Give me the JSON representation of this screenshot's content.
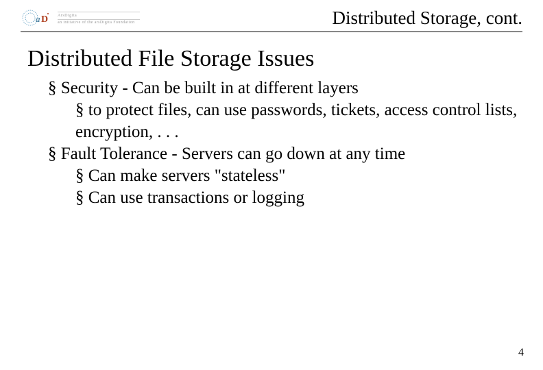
{
  "header": {
    "topic": "Distributed Storage, cont.",
    "logo": {
      "org_top": "ArsDigita",
      "org_bottom": "an initiative of the arsDigita Foundation"
    }
  },
  "slide": {
    "title": "Distributed File Storage Issues",
    "bullets": [
      {
        "text": "Security - Can be built in at different layers",
        "children": [
          {
            "text": "to protect files, can use passwords, tickets, access control lists, encryption, . . ."
          }
        ]
      },
      {
        "text": "Fault Tolerance - Servers can go down at any time",
        "children": [
          {
            "text": "Can make servers \"stateless\""
          },
          {
            "text": "Can use transactions or logging"
          }
        ]
      }
    ]
  },
  "page_number": "4"
}
